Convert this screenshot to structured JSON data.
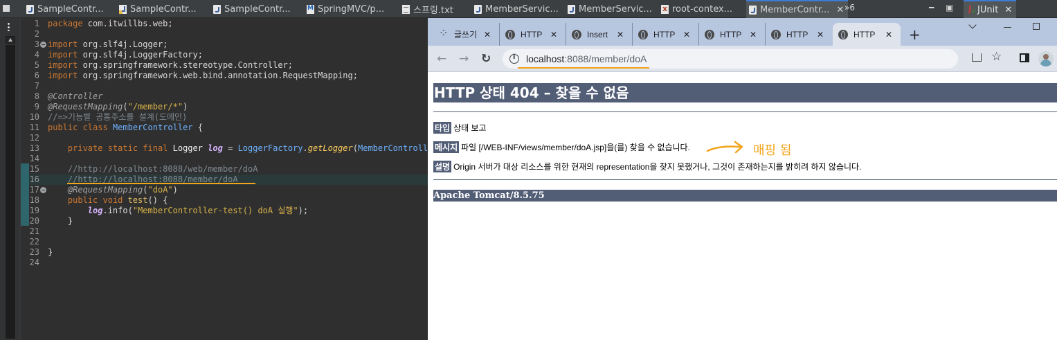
{
  "ide": {
    "tabs": [
      {
        "label": "SampleContr...",
        "icon": "java-file-icon"
      },
      {
        "label": "SampleContr...",
        "icon": "java-file-icon"
      },
      {
        "label": "SampleContr...",
        "icon": "java-file-icon"
      },
      {
        "label": "SpringMVC/p...",
        "icon": "mvc-file-icon"
      },
      {
        "label": "스프링.txt",
        "icon": "text-file-icon"
      },
      {
        "label": "MemberServic...",
        "icon": "java-file-icon"
      },
      {
        "label": "MemberServic...",
        "icon": "java-file-icon"
      },
      {
        "label": "root-contex...",
        "icon": "xml-file-icon"
      },
      {
        "label": "MemberContr...",
        "icon": "java-file-icon",
        "close": "✕"
      }
    ],
    "overflow": "»6",
    "minimize": "━",
    "maximize": "▣",
    "junit_label": "JUnit",
    "junit_close": "✕"
  },
  "editor": {
    "lines": [
      {
        "n": "1",
        "tokens": [
          [
            "kw",
            "package"
          ],
          [
            "plain",
            " com.itwillbs.web;"
          ]
        ]
      },
      {
        "n": "2",
        "tokens": []
      },
      {
        "n": "3",
        "fold": true,
        "tokens": [
          [
            "kw",
            "import"
          ],
          [
            "plain",
            " org.slf4j.Logger;"
          ]
        ]
      },
      {
        "n": "4",
        "tokens": [
          [
            "kw",
            "import"
          ],
          [
            "plain",
            " org.slf4j.LoggerFactory;"
          ]
        ]
      },
      {
        "n": "5",
        "tokens": [
          [
            "kw",
            "import"
          ],
          [
            "plain",
            " org.springframework.stereotype.Controller;"
          ]
        ]
      },
      {
        "n": "6",
        "tokens": [
          [
            "kw",
            "import"
          ],
          [
            "plain",
            " org.springframework.web.bind.annotation.RequestMapping;"
          ]
        ]
      },
      {
        "n": "7",
        "tokens": []
      },
      {
        "n": "8",
        "tokens": [
          [
            "ann",
            "@Controller"
          ]
        ]
      },
      {
        "n": "9",
        "tokens": [
          [
            "ann",
            "@RequestMapping"
          ],
          [
            "plain",
            "("
          ],
          [
            "str",
            "\"/member/*\""
          ],
          [
            "plain",
            ")"
          ]
        ]
      },
      {
        "n": "10",
        "tokens": [
          [
            "com",
            "//=>기능별 공통주소를 설계(도메인)"
          ]
        ]
      },
      {
        "n": "11",
        "tokens": [
          [
            "kw",
            "public class "
          ],
          [
            "cls",
            "MemberController"
          ],
          [
            "plain",
            " {"
          ]
        ]
      },
      {
        "n": "12",
        "tokens": []
      },
      {
        "n": "13",
        "tokens": [
          [
            "plain",
            "    "
          ],
          [
            "kw",
            "private static final "
          ],
          [
            "type",
            "Logger "
          ],
          [
            "field",
            "log"
          ],
          [
            "plain",
            " = "
          ],
          [
            "cls",
            "LoggerFactory"
          ],
          [
            "plain",
            "."
          ],
          [
            "meth",
            "getLogger"
          ],
          [
            "plain",
            "("
          ],
          [
            "cls",
            "MemberController"
          ]
        ]
      },
      {
        "n": "14",
        "tokens": []
      },
      {
        "n": "15",
        "tokens": [
          [
            "plain",
            "    "
          ],
          [
            "com",
            "//http://localhost:8088/web/member/doA"
          ]
        ]
      },
      {
        "n": "16",
        "current": true,
        "tokens": [
          [
            "plain",
            "    "
          ],
          [
            "com",
            "//http://localhost:8088/member/doA"
          ]
        ]
      },
      {
        "n": "17",
        "fold": true,
        "tokens": [
          [
            "plain",
            "    "
          ],
          [
            "ann",
            "@RequestMapping"
          ],
          [
            "plain",
            "("
          ],
          [
            "str",
            "\"doA\""
          ],
          [
            "plain",
            ")"
          ]
        ]
      },
      {
        "n": "18",
        "tokens": [
          [
            "plain",
            "    "
          ],
          [
            "kw",
            "public void "
          ],
          [
            "fn",
            "test"
          ],
          [
            "plain",
            "() {"
          ]
        ]
      },
      {
        "n": "19",
        "tokens": [
          [
            "plain",
            "        "
          ],
          [
            "field",
            "log"
          ],
          [
            "plain",
            ".info("
          ],
          [
            "str",
            "\"MemberController-test() doA 실행\""
          ],
          [
            "plain",
            ");"
          ]
        ]
      },
      {
        "n": "20",
        "tokens": [
          [
            "plain",
            "    }"
          ]
        ]
      },
      {
        "n": "21",
        "tokens": []
      },
      {
        "n": "22",
        "tokens": []
      },
      {
        "n": "23",
        "tokens": [
          [
            "plain",
            "}"
          ]
        ]
      },
      {
        "n": "24",
        "tokens": []
      }
    ]
  },
  "browser": {
    "tabs": [
      {
        "label": "글쓰기",
        "icon": "app-dots-icon"
      },
      {
        "label": "HTTP",
        "icon": "globe-icon"
      },
      {
        "label": "Insert",
        "icon": "globe-icon"
      },
      {
        "label": "HTTP",
        "icon": "globe-icon"
      },
      {
        "label": "HTTP",
        "icon": "globe-icon"
      },
      {
        "label": "HTTP",
        "icon": "globe-icon"
      },
      {
        "label": "HTTP",
        "icon": "globe-icon",
        "active": true
      }
    ],
    "tab_close": "✕",
    "new_tab": "+",
    "url_host": "localhost",
    "url_path": ":8088/member/doA",
    "back": "←",
    "forward": "→",
    "reload": "↻",
    "star": "☆"
  },
  "page": {
    "title": "HTTP 상태 404 – 찾을 수 없음",
    "type_label": "타입",
    "type_value": "상태 보고",
    "message_label": "메시지",
    "message_value": "파일 [/WEB-INF/views/member/doA.jsp]을(를) 찾을 수 없습니다.",
    "desc_label": "설명",
    "desc_value": "Origin 서버가 대상 리소스를 위한 현재의 representation을 찾지 못했거나, 그것이 존재하는지를 밝히려 하지 않습니다.",
    "footer": "Apache Tomcat/8.5.75"
  },
  "annotation": {
    "text": "매핑 됨",
    "color": "#f2a41a"
  }
}
